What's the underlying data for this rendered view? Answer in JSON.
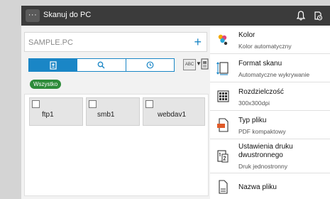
{
  "topbar": {
    "title": "Skanuj do PC",
    "menu_label": "···"
  },
  "destination": {
    "value": "SAMPLE.PC",
    "add_label": "+"
  },
  "toolbar": {
    "sort_label": "ABC"
  },
  "filter": {
    "chip_label": "Wszystko"
  },
  "addresses": [
    {
      "label": "ftp1"
    },
    {
      "label": "smb1"
    },
    {
      "label": "webdav1"
    }
  ],
  "settings": [
    {
      "title": "Kolor",
      "subtitle": "Kolor automatyczny",
      "icon": "color-icon"
    },
    {
      "title": "Format skanu",
      "subtitle": "Automatyczne wykrywanie",
      "icon": "scan-size-icon"
    },
    {
      "title": "Rozdzielczość",
      "subtitle": "300x300dpi",
      "icon": "resolution-icon"
    },
    {
      "title": "Typ pliku",
      "subtitle": "PDF kompaktowy",
      "icon": "file-type-icon"
    },
    {
      "title": "Ustawienia druku dwustronnego",
      "subtitle": "Druk jednostronny",
      "icon": "duplex-icon"
    },
    {
      "title": "Nazwa pliku",
      "subtitle": "",
      "icon": "file-name-icon"
    }
  ],
  "colors": {
    "accent": "#1a86c6",
    "chip": "#2d8b3a",
    "topbar": "#3b3b3b"
  }
}
